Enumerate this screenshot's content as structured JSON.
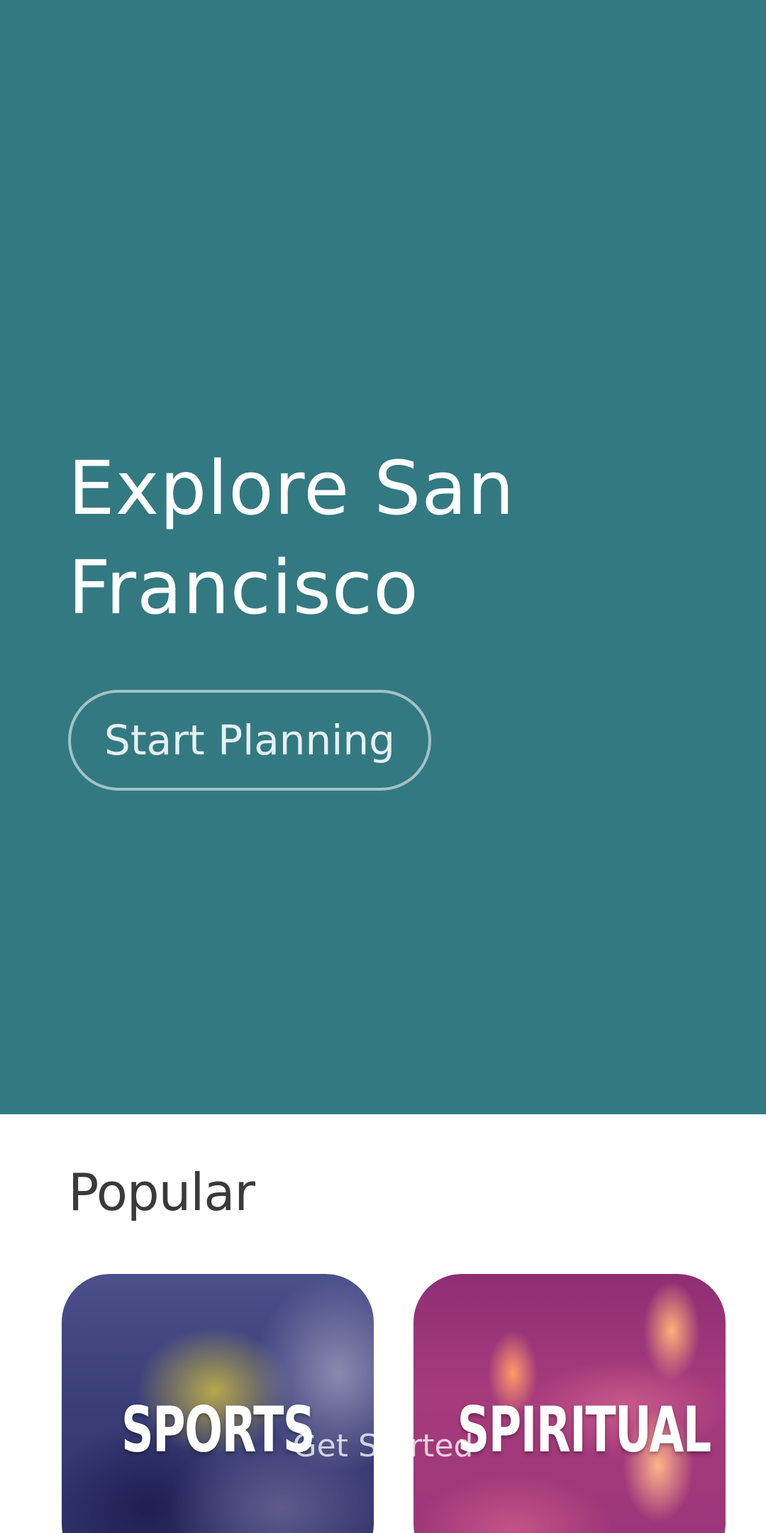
{
  "hero": {
    "title": "Explore San Francisco",
    "cta_label": "Start Planning",
    "background_color": "#337981"
  },
  "popular": {
    "heading": "Popular",
    "cards": [
      {
        "label": "SPORTS",
        "image": "football-players-photo",
        "tint": "#3a3d78"
      },
      {
        "label": "SPIRITUAL",
        "image": "lit-candles-photo",
        "tint": "#9a3578"
      }
    ]
  },
  "overlay": {
    "get_started_label": "Get Started"
  }
}
